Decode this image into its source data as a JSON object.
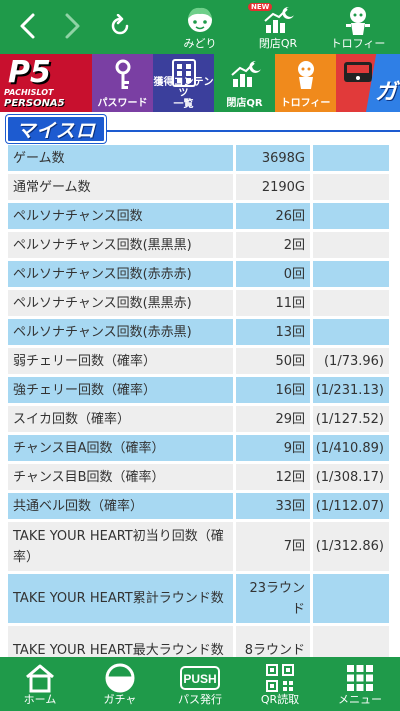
{
  "nav": {
    "back_icon": "chevron-left-icon",
    "forward_icon": "chevron-right-icon",
    "reload_icon": "reload-icon",
    "midori_label": "みどり",
    "closing_qr_label": "閉店QR",
    "new_badge": "NEW",
    "trophy_label": "トロフィー"
  },
  "menu": {
    "game_logo_line1": "P5",
    "game_logo_line2": "PACHISLOT",
    "game_logo_line3": "PERSONA5",
    "password_label": "パスワード",
    "acquired_content_label1": "獲得コンテンツ",
    "acquired_content_label2": "一覧",
    "closing_qr_label": "閉店QR",
    "trophy_label": "トロフィー",
    "gacha_label": "ガチャ",
    "tile_colors": {
      "password": "#7a3fa3",
      "content": "#3b3f9c",
      "qr": "#1f9a4a",
      "trophy": "#f08a1c",
      "gacha": "#e13a3a",
      "gacha_next": "#2f7fe6"
    }
  },
  "section": {
    "title": "マイスロ"
  },
  "stats": [
    {
      "label": "ゲーム数",
      "value": "3698G",
      "rate": "",
      "style": "blue"
    },
    {
      "label": "通常ゲーム数",
      "value": "2190G",
      "rate": "",
      "style": "gray"
    },
    {
      "label": "ペルソナチャンス回数",
      "value": "26回",
      "rate": "",
      "style": "blue"
    },
    {
      "label": "ペルソナチャンス回数(黒黒黒)",
      "value": "2回",
      "rate": "",
      "style": "gray"
    },
    {
      "label": "ペルソナチャンス回数(赤赤赤)",
      "value": "0回",
      "rate": "",
      "style": "blue"
    },
    {
      "label": "ペルソナチャンス回数(黒黒赤)",
      "value": "11回",
      "rate": "",
      "style": "gray"
    },
    {
      "label": "ペルソナチャンス回数(赤赤黒)",
      "value": "13回",
      "rate": "",
      "style": "blue"
    },
    {
      "label": "弱チェリー回数（確率）",
      "value": "50回",
      "rate": "(1/73.96)",
      "style": "gray"
    },
    {
      "label": "強チェリー回数（確率）",
      "value": "16回",
      "rate": "(1/231.13)",
      "style": "blue"
    },
    {
      "label": "スイカ回数（確率）",
      "value": "29回",
      "rate": "(1/127.52)",
      "style": "gray"
    },
    {
      "label": "チャンス目A回数（確率）",
      "value": "9回",
      "rate": "(1/410.89)",
      "style": "blue"
    },
    {
      "label": "チャンス目B回数（確率）",
      "value": "12回",
      "rate": "(1/308.17)",
      "style": "gray"
    },
    {
      "label": "共通ベル回数（確率）",
      "value": "33回",
      "rate": "(1/112.07)",
      "style": "blue"
    },
    {
      "label": "TAKE YOUR HEART初当り回数（確率）",
      "value": "7回",
      "rate": "(1/312.86)",
      "style": "gray"
    },
    {
      "label": "TAKE YOUR HEART累計ラウンド数",
      "value": "23ラウンド",
      "rate": "",
      "style": "blue"
    },
    {
      "label": "TAKE YOUR HEART最大ラウンド数",
      "value": "8ラウンド",
      "rate": "",
      "style": "gray"
    }
  ],
  "bottom_nav": {
    "home_label": "ホーム",
    "gacha_label": "ガチャ",
    "pass_label": "パス発行",
    "push_text": "PUSH",
    "qr_read_label": "QR読取",
    "menu_label": "メニュー"
  }
}
